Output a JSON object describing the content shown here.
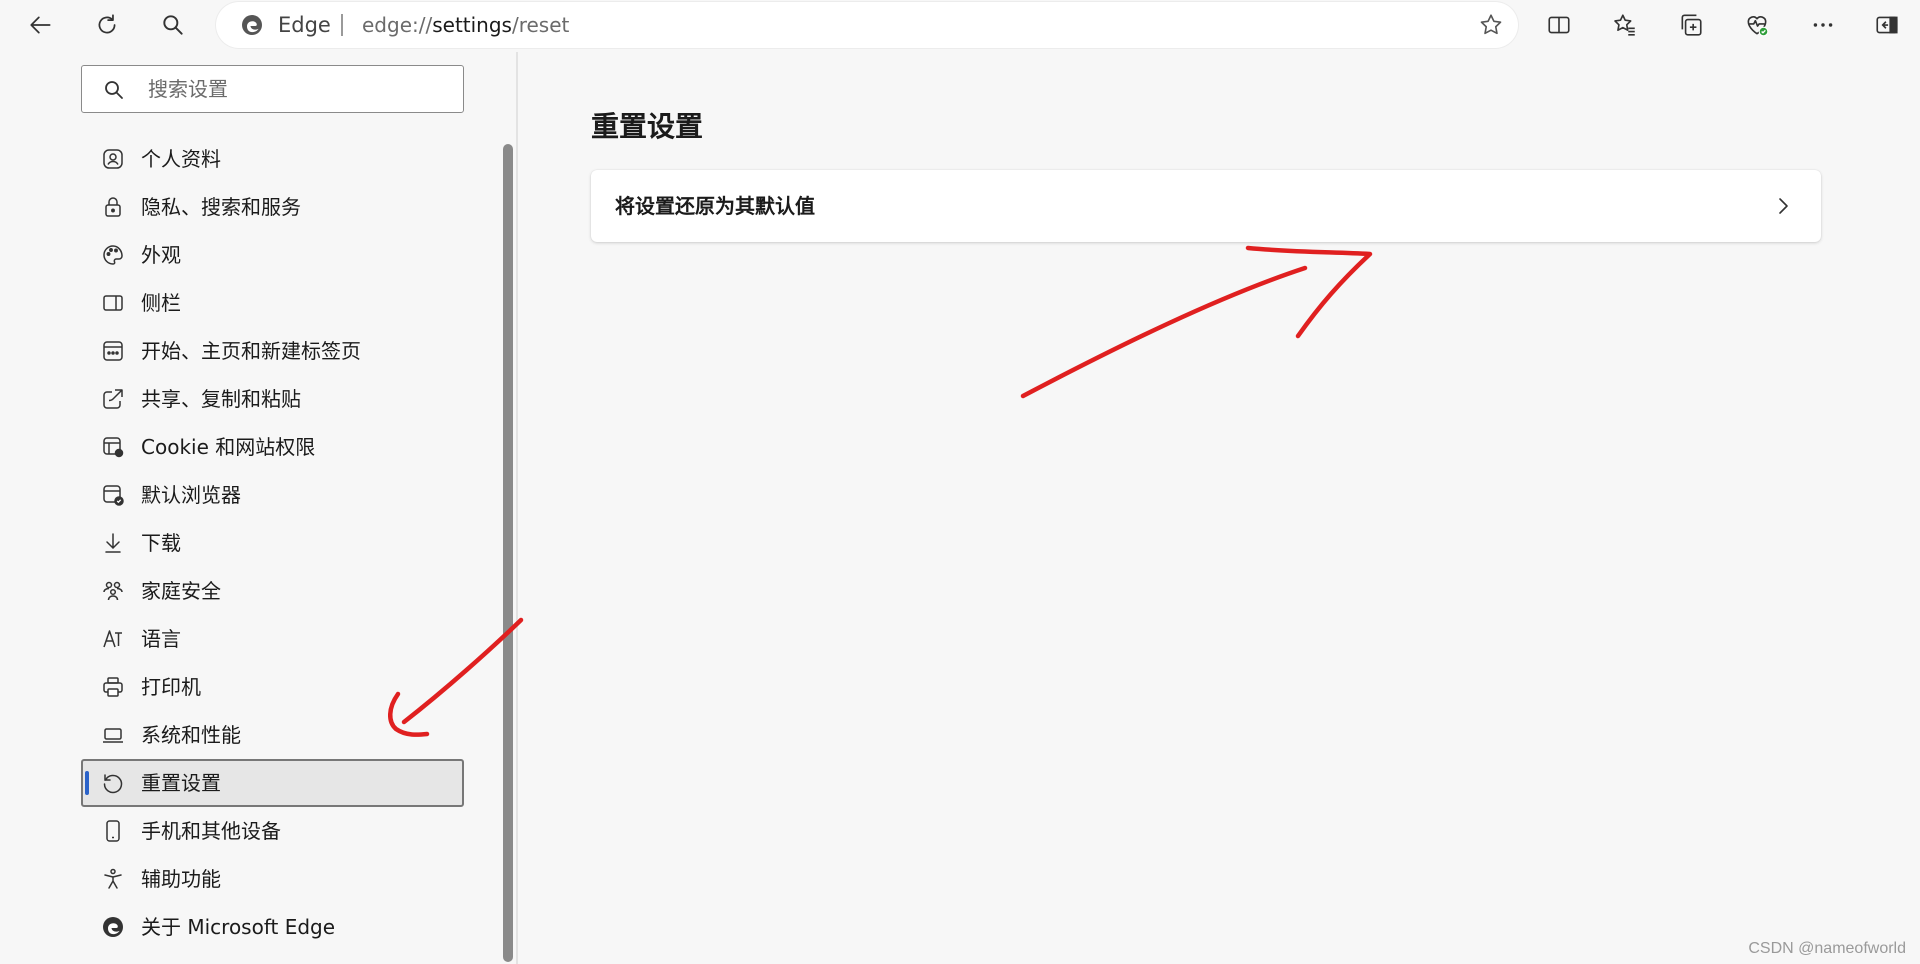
{
  "toolbar": {
    "back_icon": "back-arrow-icon",
    "refresh_icon": "refresh-icon",
    "search_icon": "search-icon"
  },
  "address_bar": {
    "brand": "Edge",
    "url_prefix": "edge://",
    "url_host": "settings",
    "url_path": "/reset"
  },
  "sidebar": {
    "search": {
      "placeholder": "搜索设置",
      "value": ""
    },
    "items": [
      {
        "label": "个人资料",
        "icon": "profile-icon"
      },
      {
        "label": "隐私、搜索和服务",
        "icon": "lock-icon"
      },
      {
        "label": "外观",
        "icon": "palette-icon"
      },
      {
        "label": "侧栏",
        "icon": "sidebar-icon"
      },
      {
        "label": "开始、主页和新建标签页",
        "icon": "home-page-icon"
      },
      {
        "label": "共享、复制和粘贴",
        "icon": "share-icon"
      },
      {
        "label": "Cookie 和网站权限",
        "icon": "site-permissions-icon"
      },
      {
        "label": "默认浏览器",
        "icon": "default-browser-icon"
      },
      {
        "label": "下载",
        "icon": "download-icon"
      },
      {
        "label": "家庭安全",
        "icon": "family-icon"
      },
      {
        "label": "语言",
        "icon": "language-icon"
      },
      {
        "label": "打印机",
        "icon": "printer-icon"
      },
      {
        "label": "系统和性能",
        "icon": "laptop-icon"
      },
      {
        "label": "重置设置",
        "icon": "reset-icon",
        "active": true
      },
      {
        "label": "手机和其他设备",
        "icon": "phone-icon"
      },
      {
        "label": "辅助功能",
        "icon": "accessibility-icon"
      },
      {
        "label": "关于 Microsoft Edge",
        "icon": "edge-logo-icon"
      }
    ]
  },
  "main": {
    "title": "重置设置",
    "card": {
      "label": "将设置还原为其默认值"
    }
  },
  "watermark": "CSDN @nameofworld",
  "colors": {
    "background": "#f7f7f7",
    "card": "#ffffff",
    "accent": "#2b63c9",
    "annotation": "#e02020",
    "scrollbar": "#8a8a8a"
  }
}
